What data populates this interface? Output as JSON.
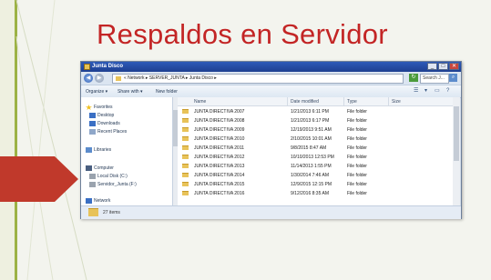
{
  "slide": {
    "title": "Respaldos en Servidor",
    "title_color": "#c32525",
    "accent_green": "#9cb245",
    "arrow_color": "#c0392b"
  },
  "window": {
    "title": "Junta Disco",
    "controls": [
      "_",
      "□",
      "✕"
    ]
  },
  "address": {
    "path": "« Network ▸ SERVER_JUNTA ▸ Junta Disco ▸",
    "search_placeholder": "Search J..."
  },
  "toolbar": {
    "organize": "Organize ▾",
    "share": "Share with ▾",
    "new_folder": "New folder"
  },
  "nav": {
    "favorites": "Favorites",
    "desktop": "Desktop",
    "downloads": "Downloads",
    "recent": "Recent Places",
    "libraries": "Libraries",
    "computer": "Computer",
    "local_disk": "Local Disk (C:)",
    "server_drive": "Servidor_Junta (F:)",
    "network": "Network"
  },
  "columns": {
    "name": "Name",
    "date": "Date modified",
    "type": "Type",
    "size": "Size"
  },
  "files": [
    {
      "name": "JUNTA DIRECTIVA 2007",
      "date": "1/21/2013 6:11 PM",
      "type": "File folder"
    },
    {
      "name": "JUNTA DIRECTIVA 2008",
      "date": "1/21/2013 6:17 PM",
      "type": "File folder"
    },
    {
      "name": "JUNTA DIRECTIVA 2009",
      "date": "12/19/2013 9:51 AM",
      "type": "File folder"
    },
    {
      "name": "JUNTA DIRECTIVA 2010",
      "date": "2/10/2015 10:01 AM",
      "type": "File folder"
    },
    {
      "name": "JUNTA DIRECTIVA 2011",
      "date": "9/8/2015 8:47 AM",
      "type": "File folder"
    },
    {
      "name": "JUNTA DIRECTIVA 2012",
      "date": "10/10/2013 12:53 PM",
      "type": "File folder"
    },
    {
      "name": "JUNTA DIRECTIVA 2013",
      "date": "11/14/2013 1:55 PM",
      "type": "File folder"
    },
    {
      "name": "JUNTA DIRECTIVA 2014",
      "date": "1/30/2014 7:46 AM",
      "type": "File folder"
    },
    {
      "name": "JUNTA DIRECTIVA 2015",
      "date": "12/9/2015 12:15 PM",
      "type": "File folder"
    },
    {
      "name": "JUNTA DIRECTIVA 2016",
      "date": "9/12/2016 8:35 AM",
      "type": "File folder"
    }
  ],
  "status": {
    "count": "27 items"
  }
}
